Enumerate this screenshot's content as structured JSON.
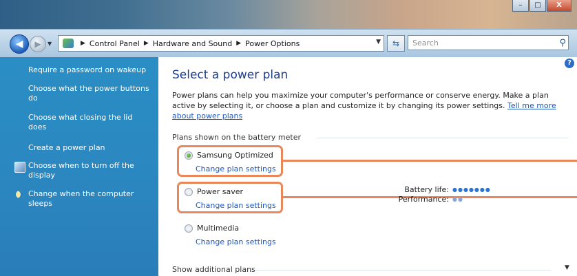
{
  "window": {
    "controls": {
      "minimize": "–",
      "maximize": "□",
      "close": "X"
    }
  },
  "nav": {
    "back_icon": "back-arrow-icon",
    "forward_icon": "forward-arrow-icon",
    "breadcrumbs": [
      "Control Panel",
      "Hardware and Sound",
      "Power Options"
    ],
    "search_placeholder": "Search"
  },
  "sidebar": {
    "items": [
      {
        "label": "Require a password on wakeup"
      },
      {
        "label": "Choose what the power buttons do"
      },
      {
        "label": "Choose what closing the lid does"
      },
      {
        "label": "Create a power plan"
      },
      {
        "label": "Choose when to turn off the display",
        "icon": "shield-icon"
      },
      {
        "label": "Change when the computer sleeps",
        "icon": "moon-icon"
      }
    ]
  },
  "main": {
    "title": "Select a power plan",
    "intro": "Power plans can help you maximize your computer's performance or conserve energy. Make a plan active by selecting it, or choose a plan and customize it by changing its power settings.",
    "intro_link": "Tell me more about power plans",
    "section_heading": "Plans shown on the battery meter",
    "plans": [
      {
        "name": "Samsung Optimized",
        "selected": true,
        "change_label": "Change plan settings"
      },
      {
        "name": "Power saver",
        "selected": false,
        "change_label": "Change plan settings"
      },
      {
        "name": "Multimedia",
        "selected": false,
        "change_label": "Change plan settings"
      }
    ],
    "battery_life_label": "Battery life:",
    "battery_life_dots": "●●●●●●●",
    "performance_label": "Performance:",
    "performance_dots": "●●",
    "show_more": "Show additional plans"
  },
  "colors": {
    "accent": "#e8885a",
    "link": "#1e56b8",
    "sidebar": "#2a86bf"
  }
}
